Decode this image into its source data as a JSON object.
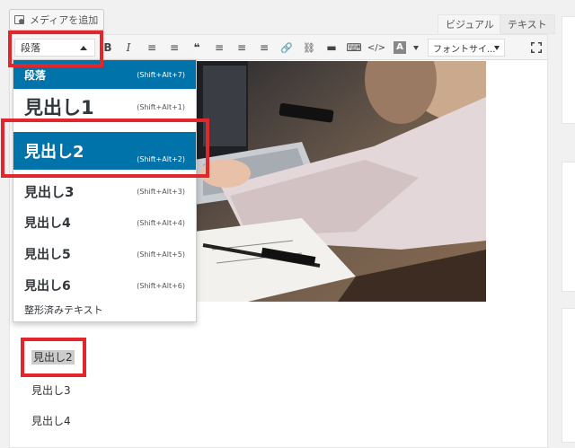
{
  "media_button": {
    "label": "メディアを追加"
  },
  "tabs": {
    "visual": "ビジュアル",
    "text": "テキスト"
  },
  "toolbar": {
    "format_select": "段落",
    "buttons": [
      "B",
      "I",
      "≡",
      "≡",
      "❝",
      "≡",
      "≡",
      "≡",
      "🔗",
      "⛓",
      "▬",
      "⌨",
      "</>"
    ],
    "text_color_label": "A",
    "font_size_select": "フォントサイ..."
  },
  "dropdown": {
    "items": [
      {
        "label": "段落",
        "shortcut": "(Shift+Alt+7)"
      },
      {
        "label": "見出し1",
        "shortcut": "(Shift+Alt+1)"
      },
      {
        "label": "見出し2",
        "shortcut": "(Shift+Alt+2)"
      },
      {
        "label": "見出し3",
        "shortcut": "(Shift+Alt+3)"
      },
      {
        "label": "見出し4",
        "shortcut": "(Shift+Alt+4)"
      },
      {
        "label": "見出し5",
        "shortcut": "(Shift+Alt+5)"
      },
      {
        "label": "見出し6",
        "shortcut": "(Shift+Alt+6)"
      },
      {
        "label": "整形済みテキスト",
        "shortcut": ""
      }
    ]
  },
  "content": {
    "lines": [
      "見出し2",
      "見出し3",
      "見出し4"
    ]
  },
  "colors": {
    "accent": "#0073aa",
    "highlight": "#e1262c"
  }
}
